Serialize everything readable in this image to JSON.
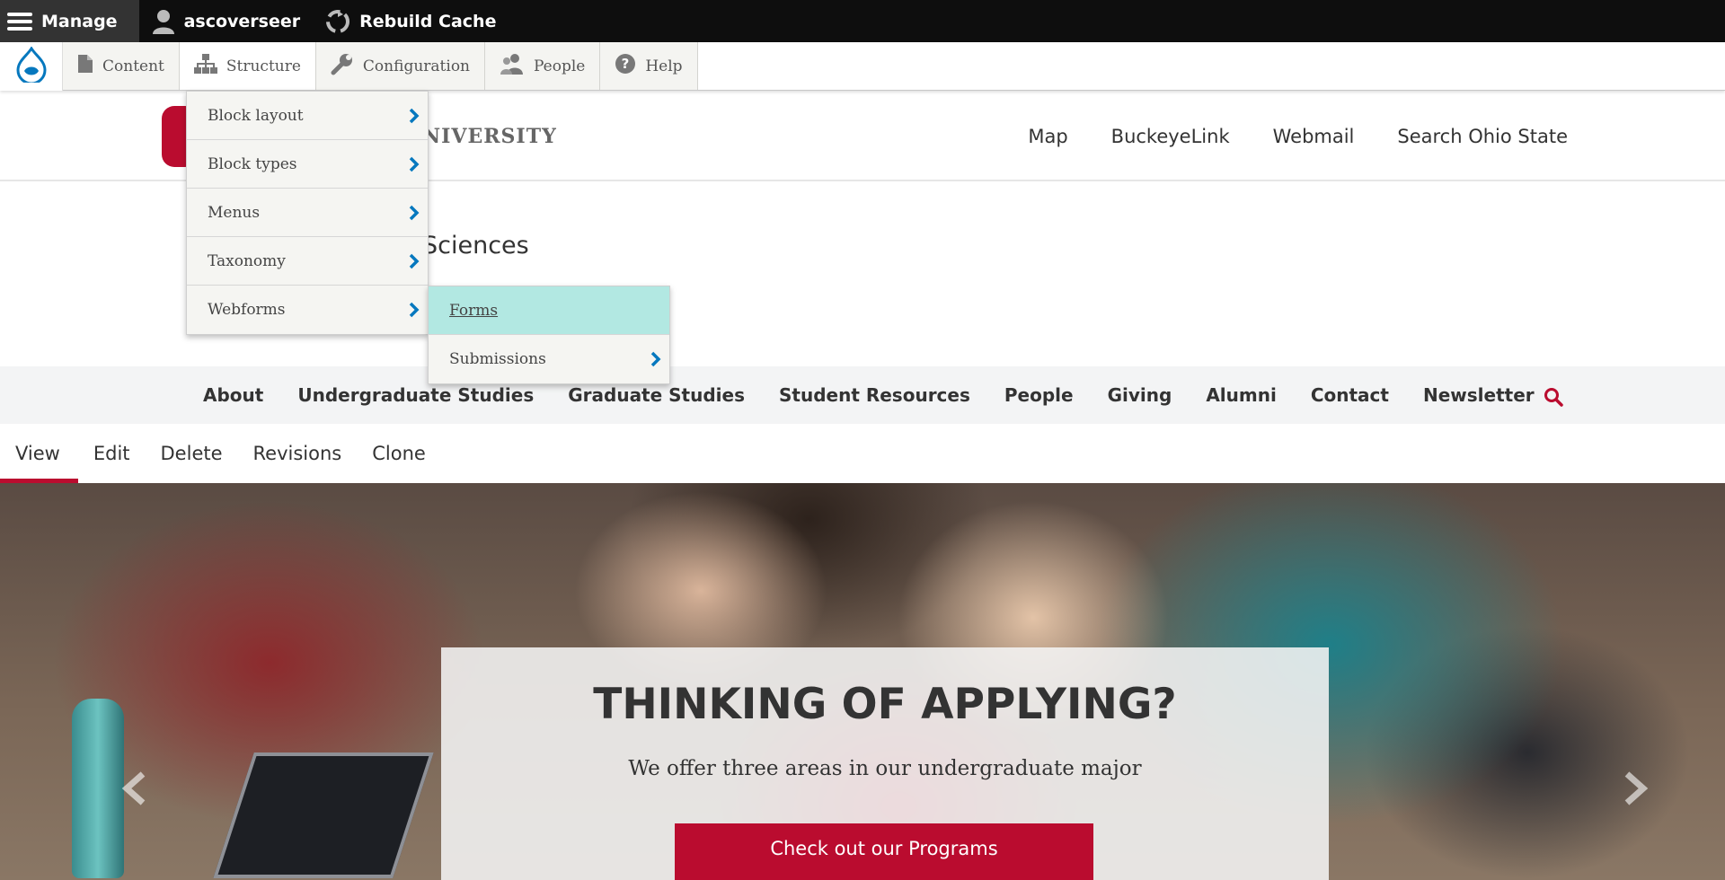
{
  "admin_bar": {
    "manage": "Manage",
    "user": "ascoverseer",
    "rebuild": "Rebuild Cache"
  },
  "toolbar": {
    "items": [
      "Content",
      "Structure",
      "Configuration",
      "People",
      "Help"
    ]
  },
  "structure_menu": {
    "items": [
      "Block layout",
      "Block types",
      "Menus",
      "Taxonomy",
      "Webforms"
    ]
  },
  "webforms_menu": {
    "items": [
      "Forms",
      "Submissions"
    ]
  },
  "header": {
    "university_fragment": "NIVERSITY",
    "links": [
      "Map",
      "BuckeyeLink",
      "Webmail",
      "Search Ohio State"
    ]
  },
  "site": {
    "name_fragment": "Sciences"
  },
  "main_nav": {
    "items": [
      "About",
      "Undergraduate Studies",
      "Graduate Studies",
      "Student Resources",
      "People",
      "Giving",
      "Alumni",
      "Contact",
      "Newsletter"
    ]
  },
  "tabs": {
    "items": [
      "View",
      "Edit",
      "Delete",
      "Revisions",
      "Clone"
    ]
  },
  "hero": {
    "title": "THINKING OF APPLYING?",
    "subtitle": "We offer three areas in our undergraduate major",
    "button": "Check out our Programs"
  },
  "colors": {
    "brand_red": "#ba0c2f",
    "drupal_blue": "#0678be",
    "highlight": "#b2e8e2"
  }
}
